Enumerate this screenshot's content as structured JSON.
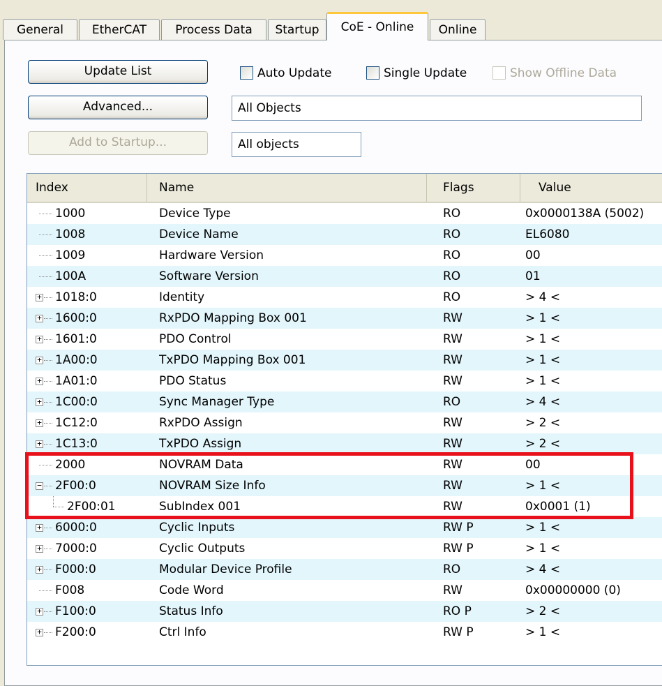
{
  "tabs": [
    "General",
    "EtherCAT",
    "Process Data",
    "Startup",
    "CoE - Online",
    "Online"
  ],
  "active_tab": "CoE - Online",
  "buttons": {
    "update_list": "Update List",
    "advanced": "Advanced...",
    "add_to_startup": "Add to Startup..."
  },
  "checkboxes": {
    "auto_update": "Auto Update",
    "single_update": "Single Update",
    "show_offline": "Show Offline Data"
  },
  "fields": {
    "objects": "All Objects",
    "filter": "All objects"
  },
  "columns": [
    "Index",
    "Name",
    "Flags",
    "Value"
  ],
  "rows": [
    {
      "index": "1000",
      "name": "Device Type",
      "flags": "RO",
      "value": "0x0000138A (5002)",
      "expander": "none"
    },
    {
      "index": "1008",
      "name": "Device Name",
      "flags": "RO",
      "value": "EL6080",
      "expander": "none"
    },
    {
      "index": "1009",
      "name": "Hardware Version",
      "flags": "RO",
      "value": "00",
      "expander": "none"
    },
    {
      "index": "100A",
      "name": "Software Version",
      "flags": "RO",
      "value": "01",
      "expander": "none"
    },
    {
      "index": "1018:0",
      "name": "Identity",
      "flags": "RO",
      "value": "> 4 <",
      "expander": "plus"
    },
    {
      "index": "1600:0",
      "name": "RxPDO Mapping Box 001",
      "flags": "RW",
      "value": "> 1 <",
      "expander": "plus"
    },
    {
      "index": "1601:0",
      "name": "PDO Control",
      "flags": "RW",
      "value": "> 1 <",
      "expander": "plus"
    },
    {
      "index": "1A00:0",
      "name": "TxPDO Mapping Box 001",
      "flags": "RW",
      "value": "> 1 <",
      "expander": "plus"
    },
    {
      "index": "1A01:0",
      "name": "PDO Status",
      "flags": "RW",
      "value": "> 1 <",
      "expander": "plus"
    },
    {
      "index": "1C00:0",
      "name": "Sync Manager Type",
      "flags": "RO",
      "value": "> 4 <",
      "expander": "plus"
    },
    {
      "index": "1C12:0",
      "name": "RxPDO Assign",
      "flags": "RW",
      "value": "> 2 <",
      "expander": "plus"
    },
    {
      "index": "1C13:0",
      "name": "TxPDO Assign",
      "flags": "RW",
      "value": "> 2 <",
      "expander": "plus"
    },
    {
      "index": "2000",
      "name": "NOVRAM Data",
      "flags": "RW",
      "value": "00",
      "expander": "none"
    },
    {
      "index": "2F00:0",
      "name": "NOVRAM Size Info",
      "flags": "RW",
      "value": "> 1 <",
      "expander": "minus"
    },
    {
      "index": "2F00:01",
      "name": "SubIndex 001",
      "flags": "RW",
      "value": "0x0001 (1)",
      "expander": "child"
    },
    {
      "index": "6000:0",
      "name": "Cyclic Inputs",
      "flags": "RW P",
      "value": "> 1 <",
      "expander": "plus"
    },
    {
      "index": "7000:0",
      "name": "Cyclic Outputs",
      "flags": "RW P",
      "value": "> 1 <",
      "expander": "plus"
    },
    {
      "index": "F000:0",
      "name": "Modular Device Profile",
      "flags": "RO",
      "value": "> 4 <",
      "expander": "plus"
    },
    {
      "index": "F008",
      "name": "Code Word",
      "flags": "RW",
      "value": "0x00000000 (0)",
      "expander": "none"
    },
    {
      "index": "F100:0",
      "name": "Status Info",
      "flags": "RO P",
      "value": "> 2 <",
      "expander": "plus"
    },
    {
      "index": "F200:0",
      "name": "Ctrl Info",
      "flags": "RW P",
      "value": "> 1 <",
      "expander": "plus"
    }
  ],
  "highlight_color": "#e8101a"
}
